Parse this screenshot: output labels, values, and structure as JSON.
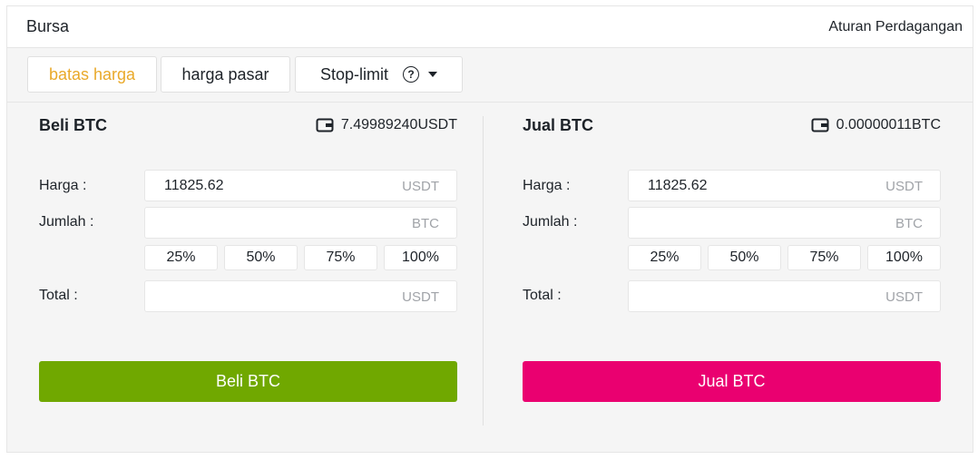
{
  "header": {
    "title": "Bursa",
    "rules_link": "Aturan Perdagangan"
  },
  "tabs": [
    {
      "label": "batas harga",
      "active": true
    },
    {
      "label": "harga pasar",
      "active": false
    },
    {
      "label": "Stop-limit",
      "active": false,
      "help_icon": "?"
    }
  ],
  "buy": {
    "title": "Beli BTC",
    "balance": "7.49989240USDT",
    "price_label": "Harga :",
    "price_value": "11825.62",
    "price_unit": "USDT",
    "amount_label": "Jumlah :",
    "amount_unit": "BTC",
    "percents": [
      "25%",
      "50%",
      "75%",
      "100%"
    ],
    "total_label": "Total :",
    "total_unit": "USDT",
    "button": "Beli BTC",
    "color": "#70a800"
  },
  "sell": {
    "title": "Jual BTC",
    "balance": "0.00000011BTC",
    "price_label": "Harga :",
    "price_value": "11825.62",
    "price_unit": "USDT",
    "amount_label": "Jumlah :",
    "amount_unit": "BTC",
    "percents": [
      "25%",
      "50%",
      "75%",
      "100%"
    ],
    "total_label": "Total :",
    "total_unit": "USDT",
    "button": "Jual BTC",
    "color": "#ea0070"
  },
  "colors": {
    "accent": "#e9a92a",
    "panel_bg": "#f5f5f5"
  }
}
